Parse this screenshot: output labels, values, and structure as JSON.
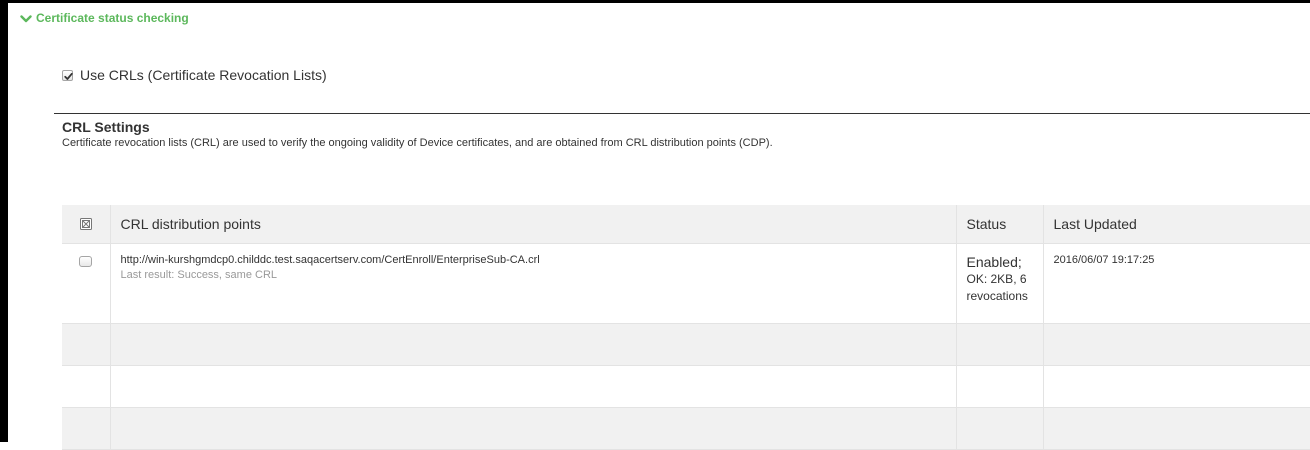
{
  "section": {
    "title": "Certificate status checking",
    "accent_color": "#5cb85c",
    "icon": "chevron-down-icon"
  },
  "use_crls": {
    "label": "Use CRLs (Certificate Revocation Lists)",
    "checked": true
  },
  "crl_settings": {
    "title": "CRL Settings",
    "description": "Certificate revocation lists (CRL) are used to verify the ongoing validity of Device certificates, and are obtained from CRL distribution points (CDP)."
  },
  "table": {
    "headers": {
      "select_all_icon": "select-all-icon",
      "distribution_points": "CRL distribution points",
      "status": "Status",
      "last_updated": "Last Updated"
    },
    "rows": [
      {
        "url": "http://win-kurshgmdcp0.childdc.test.saqacertserv.com/CertEnroll/EnterpriseSub-CA.crl",
        "last_result": "Last result: Success, same CRL",
        "status": "Enabled;",
        "status_detail": "OK: 2KB, 6 revocations",
        "last_updated": "2016/06/07 19:17:25",
        "checked": false
      }
    ],
    "empty_rows": 3
  }
}
